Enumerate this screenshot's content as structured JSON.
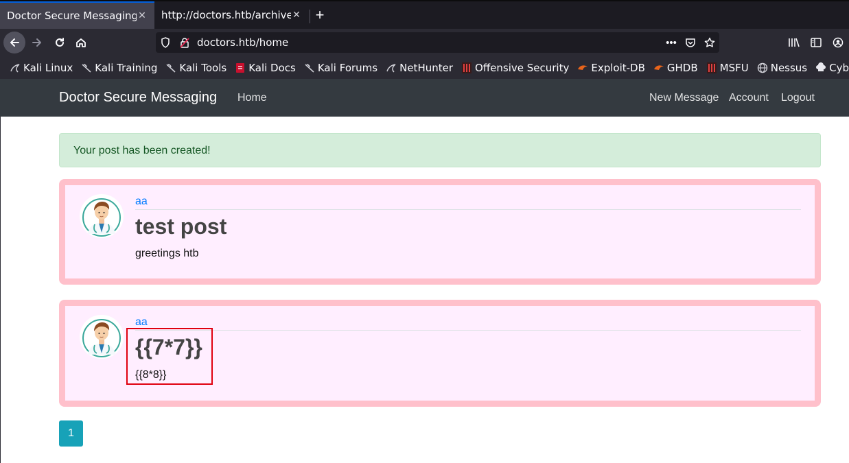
{
  "browser": {
    "tabs": [
      {
        "title": "Doctor Secure Messaging",
        "active": true
      },
      {
        "title": "http://doctors.htb/archive",
        "active": false
      }
    ],
    "new_tab_label": "+",
    "url": "doctors.htb/home",
    "bookmarks": [
      {
        "label": "Kali Linux",
        "icon": "kali-dragon-icon"
      },
      {
        "label": "Kali Training",
        "icon": "kali-dragon-icon"
      },
      {
        "label": "Kali Tools",
        "icon": "kali-dragon-icon"
      },
      {
        "label": "Kali Docs",
        "icon": "kali-docs-icon"
      },
      {
        "label": "Kali Forums",
        "icon": "kali-dragon-icon"
      },
      {
        "label": "NetHunter",
        "icon": "nethunter-icon"
      },
      {
        "label": "Offensive Security",
        "icon": "offsec-icon"
      },
      {
        "label": "Exploit-DB",
        "icon": "exploitdb-icon"
      },
      {
        "label": "GHDB",
        "icon": "ghdb-icon"
      },
      {
        "label": "MSFU",
        "icon": "msfu-icon"
      },
      {
        "label": "Nessus",
        "icon": "globe-icon"
      },
      {
        "label": "CyberChef",
        "icon": "chef-hat-icon"
      }
    ]
  },
  "site": {
    "brand": "Doctor Secure Messaging",
    "nav_home": "Home",
    "nav_new_message": "New Message",
    "nav_account": "Account",
    "nav_logout": "Logout"
  },
  "alert": {
    "message": "Your post has been created!"
  },
  "posts": [
    {
      "author": "aa",
      "title": "test post",
      "body": "greetings htb"
    },
    {
      "author": "aa",
      "title": "{{7*7}}",
      "body": "{{8*8}}"
    }
  ],
  "pagination": {
    "current_page": "1"
  },
  "colors": {
    "post_border": "#ffc0cb",
    "post_background": "#ffeeff",
    "alert_background": "#d4edda",
    "page_button": "#17a2b8",
    "highlight_box": "#e0000f"
  }
}
